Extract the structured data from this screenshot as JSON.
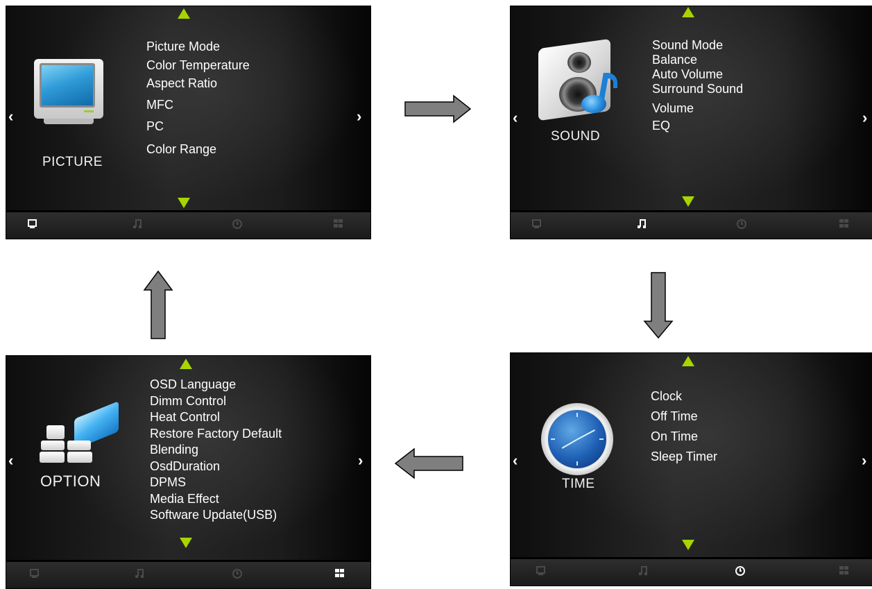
{
  "colors": {
    "accent": "#a8d400",
    "text": "#ffffff",
    "panel_bg": "#1c1c1c",
    "arrow_fill": "#7f7f7f"
  },
  "nav": {
    "left": "‹",
    "right": "›"
  },
  "panels": {
    "picture": {
      "title": "PICTURE",
      "icon": "tv-icon",
      "items": [
        "Picture Mode",
        "Color Temperature",
        "Aspect Ratio",
        "MFC",
        "PC",
        "Color Range"
      ],
      "active_tab": "picture"
    },
    "sound": {
      "title": "SOUND",
      "icon": "speaker-music-icon",
      "items": [
        "Sound Mode",
        "Balance",
        "Auto Volume",
        "Surround Sound",
        "Volume",
        "EQ"
      ],
      "active_tab": "sound"
    },
    "time": {
      "title": "TIME",
      "icon": "clock-icon",
      "items": [
        "Clock",
        "Off Time",
        "On Time",
        "Sleep Timer"
      ],
      "active_tab": "time"
    },
    "option": {
      "title": "OPTION",
      "icon": "option-tiles-icon",
      "items": [
        "OSD Language",
        "Dimm Control",
        "Heat Control",
        "Restore Factory Default",
        "Blending",
        "OsdDuration",
        "DPMS",
        "Media Effect",
        "Software Update(USB)"
      ],
      "active_tab": "option"
    }
  },
  "footer_tabs": [
    "monitor-icon",
    "music-note-icon",
    "clock-icon",
    "grid-icon"
  ],
  "flow_arrows": [
    "right",
    "down",
    "left",
    "up"
  ]
}
